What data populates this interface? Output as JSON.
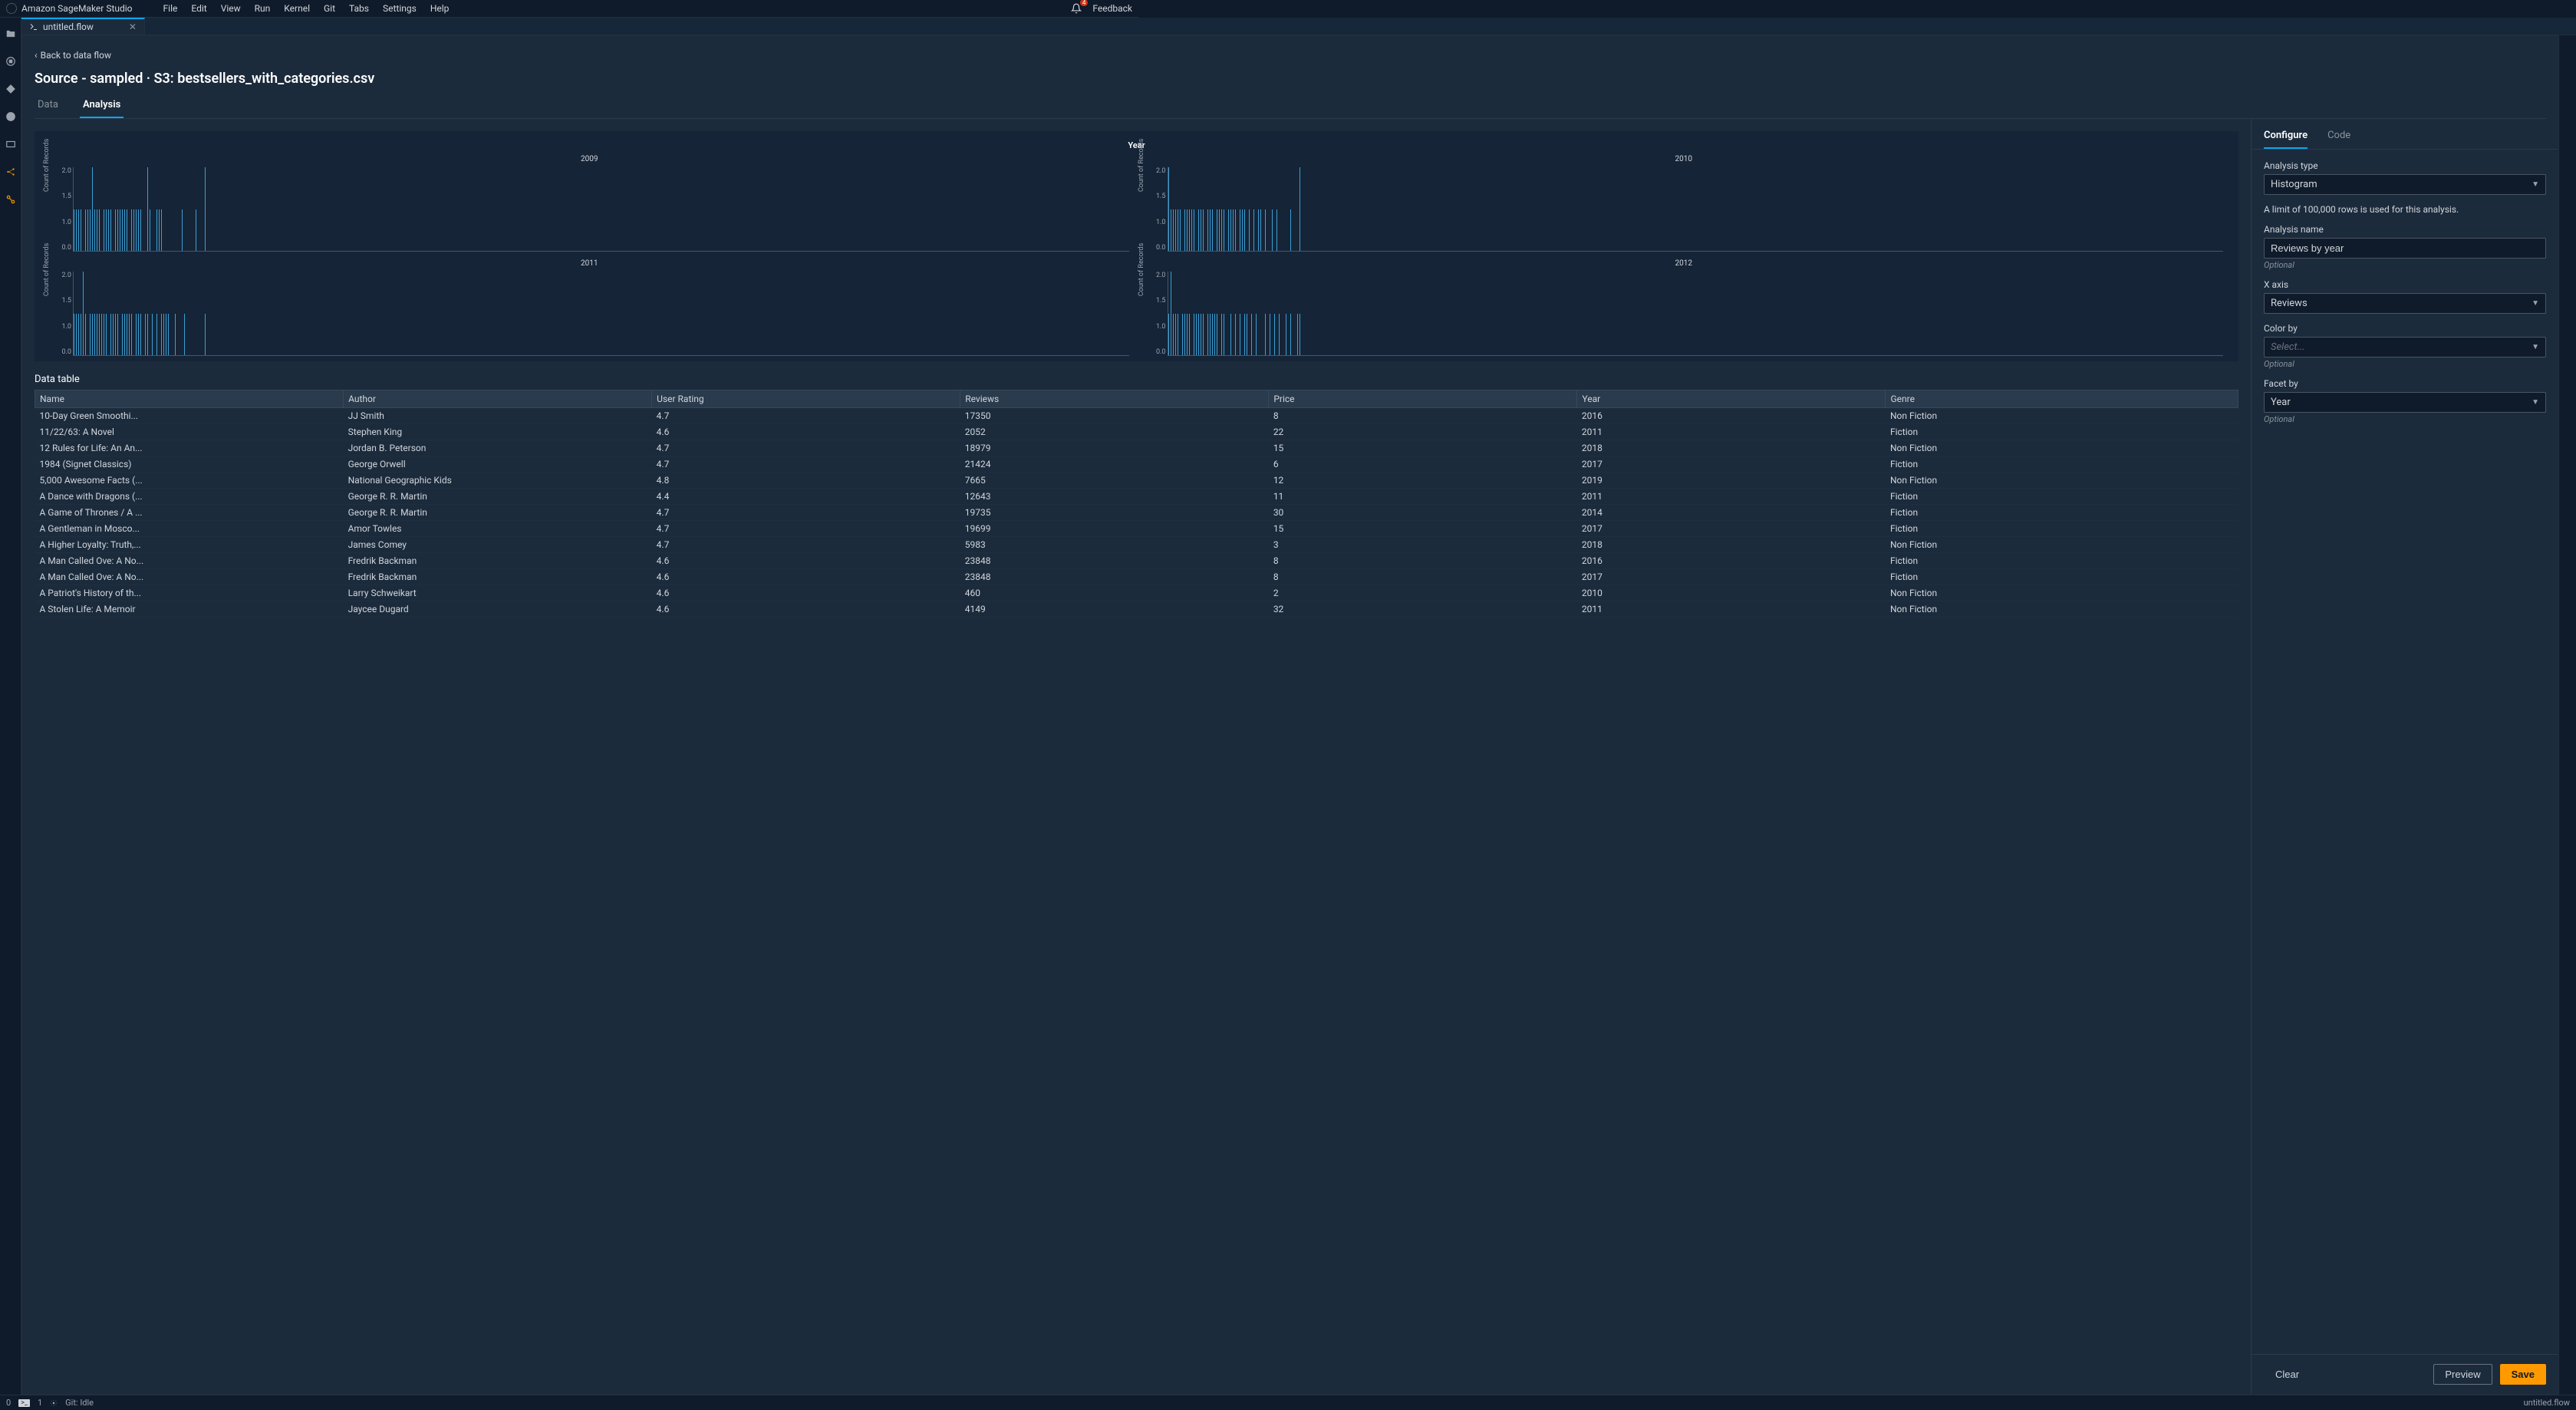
{
  "app": {
    "title": "Amazon SageMaker Studio"
  },
  "menu": [
    "File",
    "Edit",
    "View",
    "Run",
    "Kernel",
    "Git",
    "Tabs",
    "Settings",
    "Help"
  ],
  "topbar": {
    "feedback": "Feedback",
    "notifications": "4"
  },
  "tab": {
    "filename": "untitled.flow"
  },
  "flow": {
    "back": "Back to data flow",
    "source_title": "Source - sampled · S3: bestsellers_with_categories.csv",
    "tabs": {
      "data": "Data",
      "analysis": "Analysis"
    }
  },
  "chart_data": {
    "type": "bar",
    "title": "Year",
    "ylabel": "Count of Records",
    "yticks": [
      "2.0",
      "1.5",
      "1.0",
      "0.0"
    ],
    "facets": [
      {
        "label": "2009",
        "heights": [
          1,
          1,
          1,
          1,
          0,
          1,
          1,
          1,
          2,
          1,
          1,
          1,
          0,
          1,
          1,
          1,
          1,
          0,
          1,
          1,
          1,
          1,
          1,
          1,
          0,
          1,
          1,
          1,
          1,
          1,
          0,
          0,
          2,
          1,
          0,
          0,
          1,
          1,
          1,
          0,
          0,
          0,
          0,
          0,
          0,
          0,
          0,
          1,
          0,
          0,
          0,
          0,
          0,
          1,
          0,
          0,
          0,
          2
        ]
      },
      {
        "label": "2010",
        "heights": [
          2,
          1,
          1,
          1,
          1,
          1,
          0,
          1,
          1,
          1,
          1,
          1,
          0,
          1,
          1,
          1,
          0,
          1,
          1,
          1,
          0,
          1,
          1,
          1,
          1,
          0,
          1,
          1,
          1,
          1,
          0,
          1,
          1,
          1,
          0,
          1,
          0,
          1,
          0,
          1,
          1,
          0,
          1,
          0,
          0,
          1,
          0,
          1,
          0,
          0,
          0,
          0,
          0,
          1,
          0,
          0,
          0,
          2
        ]
      },
      {
        "label": "2011",
        "heights": [
          1,
          1,
          1,
          1,
          2,
          1,
          0,
          1,
          1,
          1,
          1,
          1,
          1,
          1,
          1,
          0,
          1,
          1,
          1,
          1,
          0,
          1,
          1,
          1,
          1,
          1,
          0,
          1,
          1,
          1,
          0,
          1,
          1,
          0,
          1,
          0,
          1,
          0,
          1,
          1,
          1,
          1,
          0,
          0,
          1,
          0,
          0,
          0,
          1,
          0,
          0,
          0,
          0,
          0,
          0,
          0,
          0,
          1
        ]
      },
      {
        "label": "2012",
        "heights": [
          1,
          2,
          1,
          1,
          1,
          0,
          1,
          1,
          1,
          1,
          0,
          1,
          1,
          1,
          1,
          1,
          0,
          1,
          1,
          1,
          1,
          1,
          0,
          1,
          1,
          0,
          0,
          1,
          0,
          1,
          0,
          1,
          0,
          1,
          1,
          0,
          1,
          0,
          1,
          0,
          0,
          0,
          1,
          0,
          1,
          0,
          1,
          0,
          1,
          0,
          0,
          1,
          0,
          1,
          0,
          0,
          1,
          1
        ]
      }
    ]
  },
  "table": {
    "title": "Data table",
    "columns": [
      "Name",
      "Author",
      "User Rating",
      "Reviews",
      "Price",
      "Year",
      "Genre"
    ],
    "rows": [
      [
        "10-Day Green Smoothi...",
        "JJ Smith",
        "4.7",
        "17350",
        "8",
        "2016",
        "Non Fiction"
      ],
      [
        "11/22/63: A Novel",
        "Stephen King",
        "4.6",
        "2052",
        "22",
        "2011",
        "Fiction"
      ],
      [
        "12 Rules for Life: An An...",
        "Jordan B. Peterson",
        "4.7",
        "18979",
        "15",
        "2018",
        "Non Fiction"
      ],
      [
        "1984 (Signet Classics)",
        "George Orwell",
        "4.7",
        "21424",
        "6",
        "2017",
        "Fiction"
      ],
      [
        "5,000 Awesome Facts (...",
        "National Geographic Kids",
        "4.8",
        "7665",
        "12",
        "2019",
        "Non Fiction"
      ],
      [
        "A Dance with Dragons (...",
        "George R. R. Martin",
        "4.4",
        "12643",
        "11",
        "2011",
        "Fiction"
      ],
      [
        "A Game of Thrones / A ...",
        "George R. R. Martin",
        "4.7",
        "19735",
        "30",
        "2014",
        "Fiction"
      ],
      [
        "A Gentleman in Mosco...",
        "Amor Towles",
        "4.7",
        "19699",
        "15",
        "2017",
        "Fiction"
      ],
      [
        "A Higher Loyalty: Truth,...",
        "James Comey",
        "4.7",
        "5983",
        "3",
        "2018",
        "Non Fiction"
      ],
      [
        "A Man Called Ove: A No...",
        "Fredrik Backman",
        "4.6",
        "23848",
        "8",
        "2016",
        "Fiction"
      ],
      [
        "A Man Called Ove: A No...",
        "Fredrik Backman",
        "4.6",
        "23848",
        "8",
        "2017",
        "Fiction"
      ],
      [
        "A Patriot's History of th...",
        "Larry Schweikart",
        "4.6",
        "460",
        "2",
        "2010",
        "Non Fiction"
      ],
      [
        "A Stolen Life: A Memoir",
        "Jaycee Dugard",
        "4.6",
        "4149",
        "32",
        "2011",
        "Non Fiction"
      ]
    ]
  },
  "config": {
    "tabs": {
      "configure": "Configure",
      "code": "Code"
    },
    "analysis_type_label": "Analysis type",
    "analysis_type_value": "Histogram",
    "limit_text": "A limit of 100,000 rows is used for this analysis.",
    "analysis_name_label": "Analysis name",
    "analysis_name_value": "Reviews by year",
    "xaxis_label": "X axis",
    "xaxis_value": "Reviews",
    "colorby_label": "Color by",
    "colorby_placeholder": "Select...",
    "facetby_label": "Facet by",
    "facetby_value": "Year",
    "optional": "Optional",
    "clear": "Clear",
    "preview": "Preview",
    "save": "Save"
  },
  "status": {
    "zero": "0",
    "one": "1",
    "git": "Git: Idle",
    "filename": "untitled.flow"
  }
}
